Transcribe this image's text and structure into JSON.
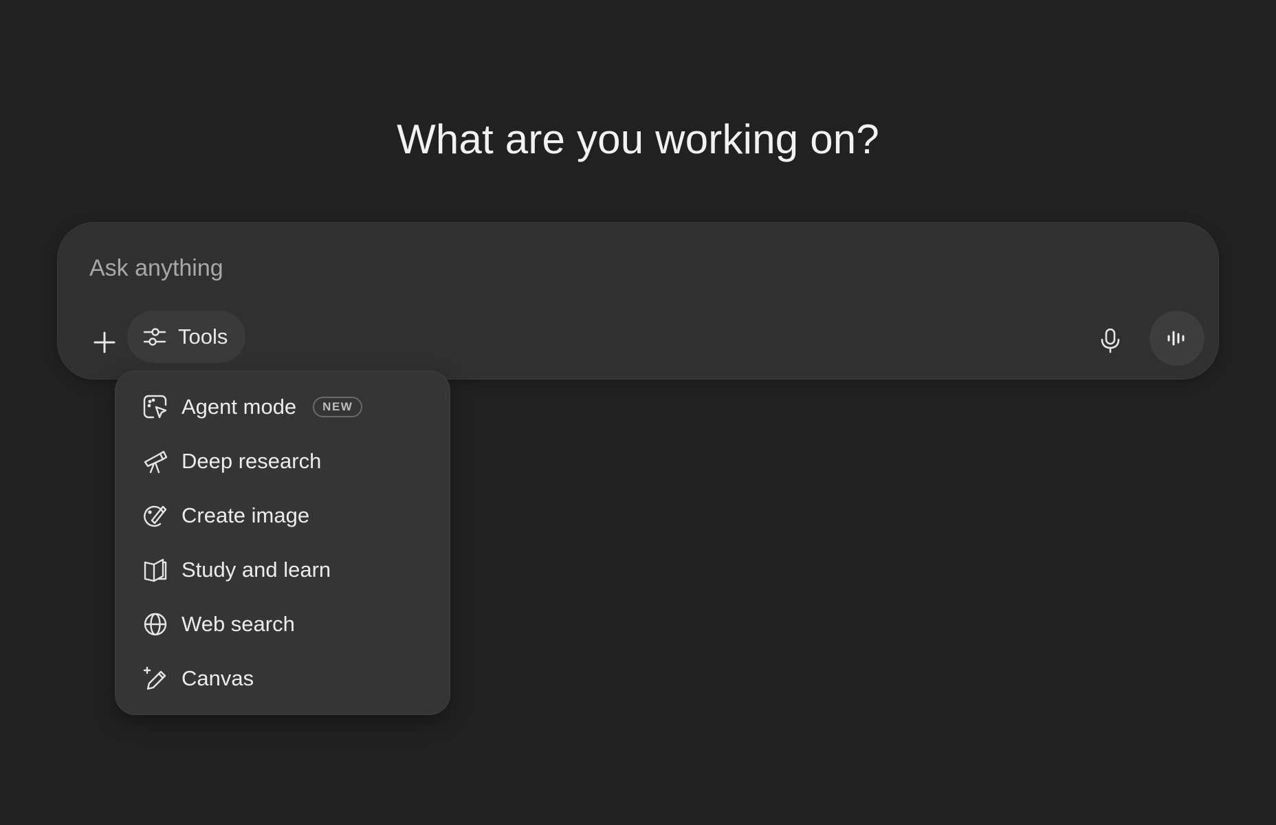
{
  "heading": "What are you working on?",
  "composer": {
    "placeholder": "Ask anything",
    "tools_label": "Tools",
    "icons": {
      "plus": "plus-icon",
      "tools": "sliders-icon",
      "mic": "microphone-icon",
      "voice": "voice-waveform-icon"
    }
  },
  "tools_menu": {
    "items": [
      {
        "label": "Agent mode",
        "icon": "agent-cursor-icon",
        "badge": "NEW"
      },
      {
        "label": "Deep research",
        "icon": "telescope-icon"
      },
      {
        "label": "Create image",
        "icon": "palette-brush-icon"
      },
      {
        "label": "Study and learn",
        "icon": "open-book-icon"
      },
      {
        "label": "Web search",
        "icon": "globe-icon"
      },
      {
        "label": "Canvas",
        "icon": "sparkle-pencil-icon"
      }
    ]
  },
  "colors": {
    "background": "#212121",
    "composer": "#303030",
    "menu": "#353535",
    "text": "#ececec",
    "placeholder": "#a8a8a8"
  }
}
